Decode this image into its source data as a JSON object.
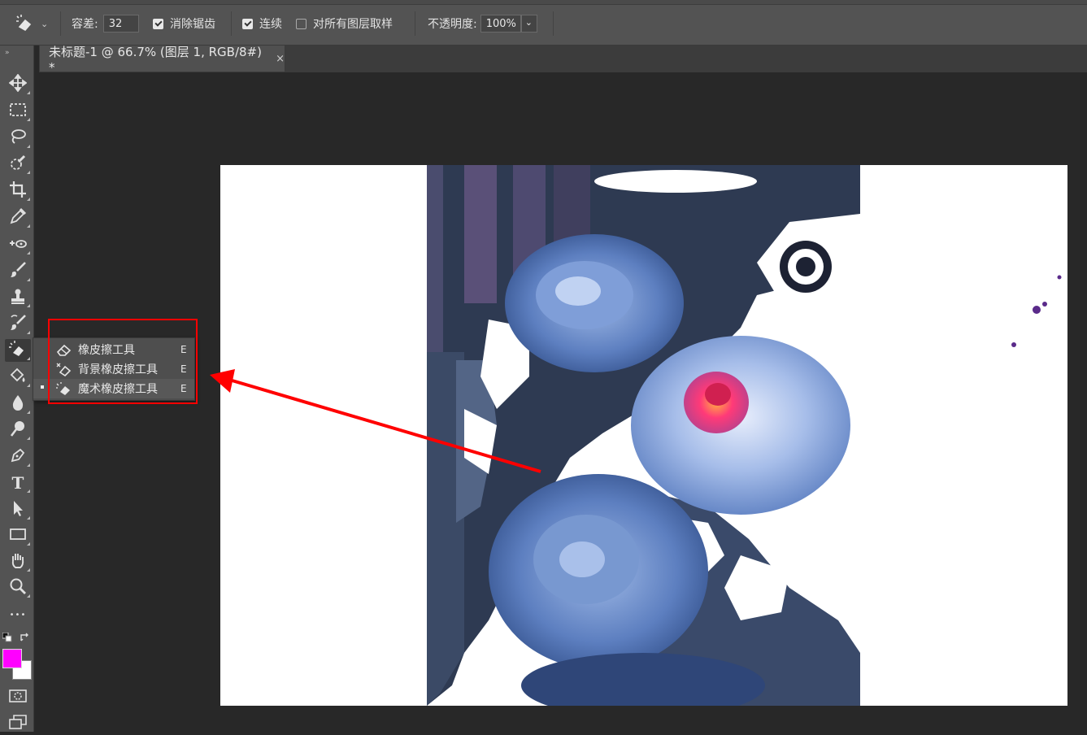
{
  "options_bar": {
    "tolerance_label": "容差:",
    "tolerance_value": "32",
    "antialias_label": "消除锯齿",
    "antialias_checked": true,
    "contiguous_label": "连续",
    "contiguous_checked": true,
    "sample_all_layers_label": "对所有图层取样",
    "sample_all_layers_checked": false,
    "opacity_label": "不透明度:",
    "opacity_value": "100%"
  },
  "document_tab": {
    "title": "未标题-1 @ 66.7% (图层 1, RGB/8#) *",
    "close": "×"
  },
  "tools": [
    {
      "name": "move-tool",
      "icon": "move-icon"
    },
    {
      "name": "marquee-tool",
      "icon": "rect-marquee-icon"
    },
    {
      "name": "lasso-tool",
      "icon": "lasso-icon"
    },
    {
      "name": "quick-select-tool",
      "icon": "quick-select-icon"
    },
    {
      "name": "crop-tool",
      "icon": "crop-icon"
    },
    {
      "name": "eyedropper-tool",
      "icon": "eyedropper-icon"
    },
    {
      "name": "healing-tool",
      "icon": "healing-icon"
    },
    {
      "name": "brush-tool",
      "icon": "brush-icon"
    },
    {
      "name": "stamp-tool",
      "icon": "stamp-icon"
    },
    {
      "name": "history-brush-tool",
      "icon": "history-brush-icon"
    },
    {
      "name": "eraser-tool",
      "icon": "magic-eraser-icon"
    },
    {
      "name": "paint-bucket-tool",
      "icon": "paint-bucket-icon"
    },
    {
      "name": "blur-tool",
      "icon": "drop-icon"
    },
    {
      "name": "dodge-tool",
      "icon": "dodge-icon"
    },
    {
      "name": "pen-tool",
      "icon": "pen-icon"
    },
    {
      "name": "type-tool",
      "icon": "type-icon",
      "glyph": "T"
    },
    {
      "name": "path-select-tool",
      "icon": "arrow-icon"
    },
    {
      "name": "shape-tool",
      "icon": "rectangle-icon"
    },
    {
      "name": "hand-tool",
      "icon": "hand-icon"
    },
    {
      "name": "zoom-tool",
      "icon": "zoom-icon"
    },
    {
      "name": "more-tools",
      "icon": "ellipsis-icon",
      "glyph": "•••"
    }
  ],
  "colors": {
    "foreground": "#ff00ff",
    "background": "#ffffff",
    "annotation": "#ff0000"
  },
  "eraser_flyout": [
    {
      "label": "橡皮擦工具",
      "shortcut": "E",
      "icon": "eraser-icon"
    },
    {
      "label": "背景橡皮擦工具",
      "shortcut": "E",
      "icon": "background-eraser-icon"
    },
    {
      "label": "魔术橡皮擦工具",
      "shortcut": "E",
      "icon": "magic-eraser-icon"
    }
  ]
}
